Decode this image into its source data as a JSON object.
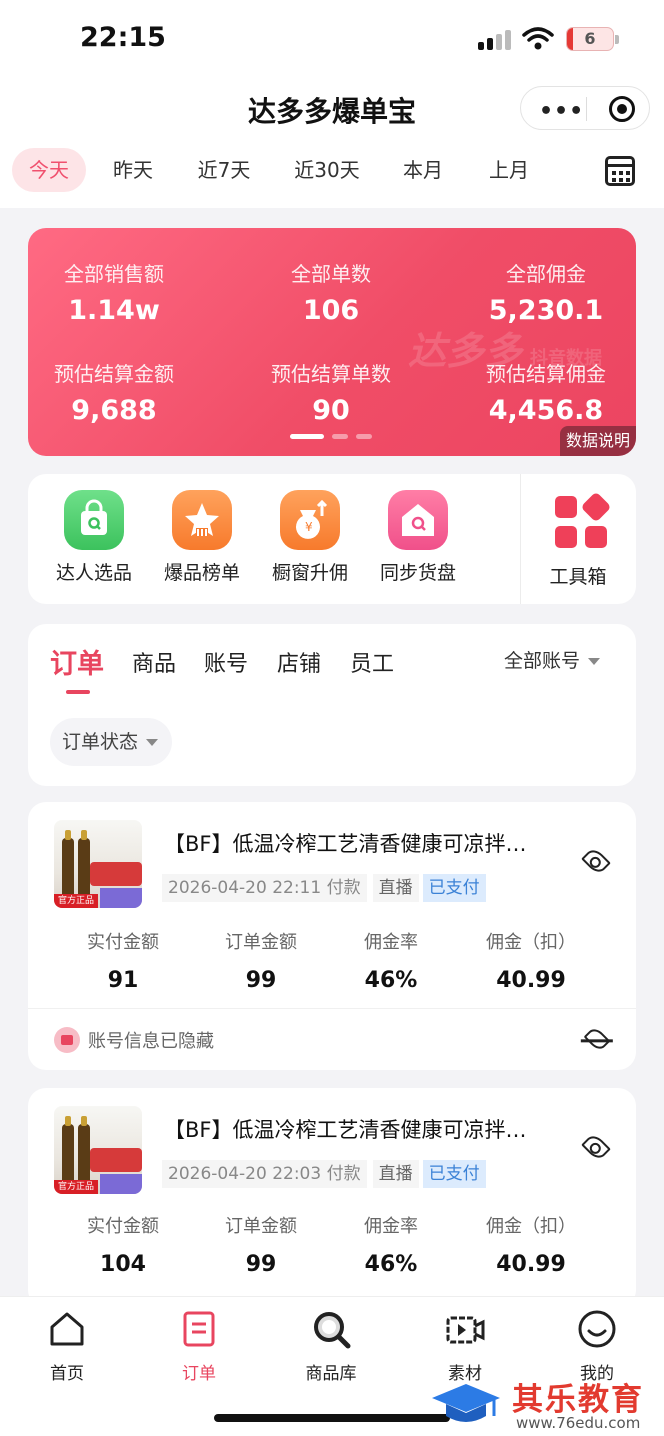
{
  "status_bar": {
    "time": "22:15",
    "battery": "6"
  },
  "app": {
    "title": "达多多爆单宝",
    "more": "•••"
  },
  "date_tabs": [
    "今天",
    "昨天",
    "近7天",
    "近30天",
    "本月",
    "上月"
  ],
  "stats": {
    "items": [
      {
        "label": "全部销售额",
        "value": "1.14w"
      },
      {
        "label": "全部单数",
        "value": "106"
      },
      {
        "label": "全部佣金",
        "value": "5,230.1"
      },
      {
        "label": "预估结算金额",
        "value": "9,688"
      },
      {
        "label": "预估结算单数",
        "value": "90"
      },
      {
        "label": "预估结算佣金",
        "value": "4,456.8"
      }
    ],
    "watermark": "达多多",
    "watermark_sub": "抖音数据",
    "data_note": "数据说明"
  },
  "tools": [
    "达人选品",
    "爆品榜单",
    "橱窗升佣",
    "同步货盘",
    "工具箱"
  ],
  "order_tabs": [
    "订单",
    "商品",
    "账号",
    "店铺",
    "员工"
  ],
  "account_filter": "全部账号",
  "status_filter": "订单状态",
  "metric_labels": [
    "实付金额",
    "订单金额",
    "佣金率",
    "佣金（扣）"
  ],
  "orders": [
    {
      "title": "【BF】低温冷榨工艺清香健康可凉拌…",
      "time": "2026-04-20 22:11 付款",
      "channel": "直播",
      "status": "已支付",
      "values": [
        "91",
        "99",
        "46%",
        "40.99"
      ],
      "account_text": "账号信息已隐藏"
    },
    {
      "title": "【BF】低温冷榨工艺清香健康可凉拌…",
      "time": "2026-04-20 22:03 付款",
      "channel": "直播",
      "status": "已支付",
      "values": [
        "104",
        "99",
        "46%",
        "40.99"
      ]
    }
  ],
  "product_thumb_tag": "官方正品",
  "tabbar": [
    "首页",
    "订单",
    "商品库",
    "素材",
    "我的"
  ],
  "brand_watermark": {
    "name": "其乐教育",
    "url": "www.76edu.com"
  },
  "colors": {
    "accent": "#e8455f",
    "card_gradient": "#f04d67",
    "paid_bg": "#dcebfd"
  }
}
